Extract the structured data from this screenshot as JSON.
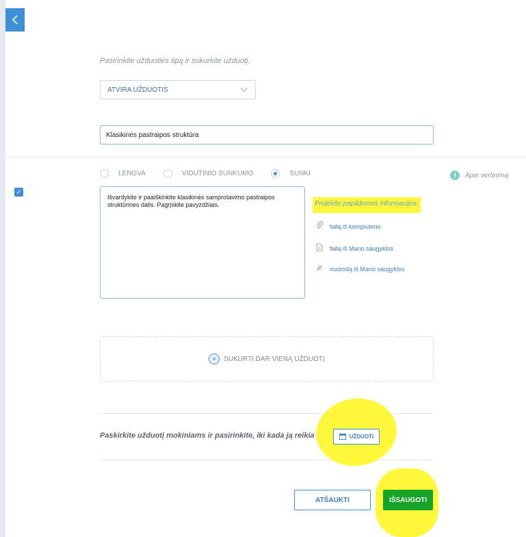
{
  "intro_text": "Pasirinkite užduoties tipą ir sukurkite užduotį.",
  "task_type": {
    "selected": "ATVIRA UŽDUOTIS"
  },
  "task_title": {
    "value": "Klasikinės pastraipos struktūra"
  },
  "difficulty": {
    "options": [
      "LENGVA",
      "VIDUTINIO SUNKUMO",
      "SUNKI"
    ],
    "selected": "SUNKI"
  },
  "info_link": "Apie vertinimą",
  "task_body": "Išvardykite ir paaiškinkite klasikinės samprotavimo pastraipos struktūrines dalis. Pagrįskite pavyzdžiais.",
  "attachments": {
    "title": "Pridėkite papildomos informacijos:",
    "items": [
      {
        "label": "failą iš kompiuterio",
        "icon": "paperclip-icon"
      },
      {
        "label": "failą iš Mano saugyklos",
        "icon": "document-icon"
      },
      {
        "label": "nuorodą iš Mano saugyklos",
        "icon": "link-icon"
      }
    ]
  },
  "create_another": "SUKURTI DAR VIENĄ UŽDUOTĮ",
  "assign": {
    "text": "Paskirkite užduotį mokiniams ir pasirinkite, iki kada ją reikia atlikti.",
    "button": "UŽDUOTI"
  },
  "actions": {
    "cancel": "ATŠAUKTI",
    "save": "IŠSAUGOTI"
  },
  "colors": {
    "accent": "#3d8fd6",
    "save": "#17a327",
    "highlight": "#fff83a"
  }
}
